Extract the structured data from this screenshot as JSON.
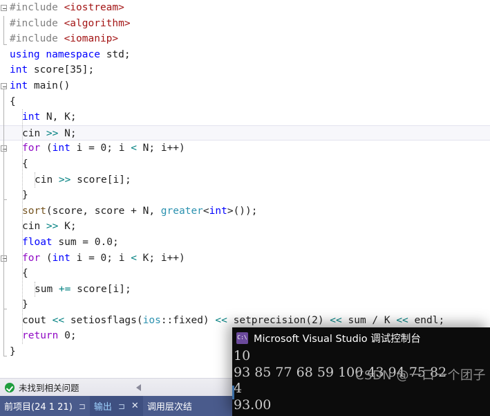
{
  "editor": {
    "language": "cpp",
    "lines": [
      {
        "indent": 0,
        "fold": "open",
        "tokens": [
          {
            "c": "t-pre",
            "t": "#include "
          },
          {
            "c": "t-str",
            "t": "<iostream>"
          }
        ]
      },
      {
        "indent": 0,
        "fold": "bar",
        "tokens": [
          {
            "c": "t-pre",
            "t": "#include "
          },
          {
            "c": "t-str",
            "t": "<algorithm>"
          }
        ]
      },
      {
        "indent": 0,
        "fold": "barend",
        "tokens": [
          {
            "c": "t-pre",
            "t": "#include "
          },
          {
            "c": "t-str",
            "t": "<iomanip>"
          }
        ]
      },
      {
        "indent": 0,
        "tokens": [
          {
            "c": "t-kw",
            "t": "using namespace "
          },
          {
            "c": "t-txt",
            "t": "std;"
          }
        ]
      },
      {
        "indent": 0,
        "tokens": [
          {
            "c": "t-kw",
            "t": "int"
          },
          {
            "c": "t-txt",
            "t": " score[35];"
          }
        ]
      },
      {
        "indent": 0,
        "fold": "open",
        "tokens": [
          {
            "c": "t-kw",
            "t": "int"
          },
          {
            "c": "t-txt",
            "t": " main()"
          }
        ]
      },
      {
        "indent": 0,
        "tokens": [
          {
            "c": "t-txt",
            "t": "{"
          }
        ]
      },
      {
        "indent": 1,
        "tokens": [
          {
            "c": "t-kw",
            "t": "int"
          },
          {
            "c": "t-txt",
            "t": " N, K;"
          }
        ]
      },
      {
        "indent": 1,
        "current": true,
        "tokens": [
          {
            "c": "t-txt",
            "t": "cin "
          },
          {
            "c": "t-op",
            "t": ">>"
          },
          {
            "c": "t-txt",
            "t": " N;"
          }
        ]
      },
      {
        "indent": 1,
        "fold": "open",
        "tokens": [
          {
            "c": "t-kw2",
            "t": "for"
          },
          {
            "c": "t-txt",
            "t": " ("
          },
          {
            "c": "t-kw",
            "t": "int"
          },
          {
            "c": "t-txt",
            "t": " i = 0; i "
          },
          {
            "c": "t-op",
            "t": "<"
          },
          {
            "c": "t-txt",
            "t": " N; i++)"
          }
        ]
      },
      {
        "indent": 1,
        "tokens": [
          {
            "c": "t-txt",
            "t": "{"
          }
        ]
      },
      {
        "indent": 2,
        "tokens": [
          {
            "c": "t-txt",
            "t": "cin "
          },
          {
            "c": "t-op",
            "t": ">>"
          },
          {
            "c": "t-txt",
            "t": " score[i];"
          }
        ]
      },
      {
        "indent": 1,
        "fold": "end",
        "tokens": [
          {
            "c": "t-txt",
            "t": "}"
          }
        ]
      },
      {
        "indent": 1,
        "tokens": [
          {
            "c": "t-fn",
            "t": "sort"
          },
          {
            "c": "t-txt",
            "t": "(score, score + N, "
          },
          {
            "c": "t-type",
            "t": "greater"
          },
          {
            "c": "t-txt",
            "t": "<"
          },
          {
            "c": "t-kw",
            "t": "int"
          },
          {
            "c": "t-txt",
            "t": ">());"
          }
        ]
      },
      {
        "indent": 1,
        "tokens": [
          {
            "c": "t-txt",
            "t": "cin "
          },
          {
            "c": "t-op",
            "t": ">>"
          },
          {
            "c": "t-txt",
            "t": " K;"
          }
        ]
      },
      {
        "indent": 1,
        "tokens": [
          {
            "c": "t-kw",
            "t": "float"
          },
          {
            "c": "t-txt",
            "t": " sum = 0.0;"
          }
        ]
      },
      {
        "indent": 1,
        "fold": "open",
        "tokens": [
          {
            "c": "t-kw2",
            "t": "for"
          },
          {
            "c": "t-txt",
            "t": " ("
          },
          {
            "c": "t-kw",
            "t": "int"
          },
          {
            "c": "t-txt",
            "t": " i = 0; i "
          },
          {
            "c": "t-op",
            "t": "<"
          },
          {
            "c": "t-txt",
            "t": " K; i++)"
          }
        ]
      },
      {
        "indent": 1,
        "tokens": [
          {
            "c": "t-txt",
            "t": "{"
          }
        ]
      },
      {
        "indent": 2,
        "tokens": [
          {
            "c": "t-txt",
            "t": "sum "
          },
          {
            "c": "t-op",
            "t": "+="
          },
          {
            "c": "t-txt",
            "t": " score[i];"
          }
        ]
      },
      {
        "indent": 1,
        "fold": "end",
        "tokens": [
          {
            "c": "t-txt",
            "t": "}"
          }
        ]
      },
      {
        "indent": 1,
        "tokens": [
          {
            "c": "t-txt",
            "t": "cout "
          },
          {
            "c": "t-op",
            "t": "<<"
          },
          {
            "c": "t-txt",
            "t": " setiosflags("
          },
          {
            "c": "t-type",
            "t": "ios"
          },
          {
            "c": "t-txt",
            "t": "::fixed) "
          },
          {
            "c": "t-op",
            "t": "<<"
          },
          {
            "c": "t-txt",
            "t": " setprecision(2) "
          },
          {
            "c": "t-op",
            "t": "<<"
          },
          {
            "c": "t-txt",
            "t": " sum / K "
          },
          {
            "c": "t-op",
            "t": "<<"
          },
          {
            "c": "t-txt",
            "t": " endl;"
          }
        ]
      },
      {
        "indent": 1,
        "tokens": [
          {
            "c": "t-kw2",
            "t": "return"
          },
          {
            "c": "t-txt",
            "t": " 0;"
          }
        ]
      },
      {
        "indent": 0,
        "fold": "end",
        "tokens": [
          {
            "c": "t-txt",
            "t": "}"
          }
        ]
      }
    ],
    "colors": {
      "background": "#ffffff",
      "preprocessor": "#808080",
      "string": "#a31515",
      "keyword": "#0000ff",
      "control_keyword": "#8f08c4",
      "type": "#2b91af",
      "function": "#74531f",
      "operator": "#008080",
      "plain": "#1f1f1f",
      "current_line_bg": "#f7f7fb"
    }
  },
  "problem_bar": {
    "status_text": "未找到相关问题",
    "status_icon": "check-circle-icon",
    "collapse_icon": "left-triangle-icon"
  },
  "tabbar": {
    "accent": "#4a5b8c",
    "tabs": [
      {
        "label": "前项目(24 1 21)",
        "active": false,
        "pin": "⊐",
        "close": ""
      },
      {
        "label": "输出",
        "active": true,
        "pin": "⊐",
        "close": "✕"
      },
      {
        "label": "调用层次结",
        "active": false,
        "pin": "",
        "close": ""
      }
    ]
  },
  "console": {
    "title": "Microsoft Visual Studio 调试控制台",
    "icon": "cmd-prompt-icon",
    "icon_glyph": "C:\\",
    "lines": [
      "10",
      "93 85 77 68 59 100 43 94 75 82",
      "4",
      "93.00"
    ],
    "watermark": "CSDN @一口一个团子",
    "background": "#0c0c0c",
    "text_color": "#cccccc"
  }
}
